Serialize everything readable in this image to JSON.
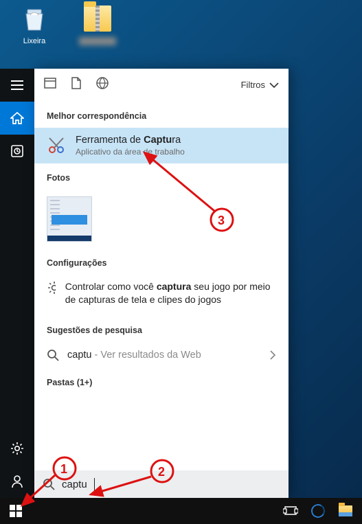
{
  "desktop": {
    "recycle_bin_label": "Lixeira",
    "zip_label_blurred": true
  },
  "rail": {
    "items": [
      "menu",
      "home",
      "timeline"
    ],
    "bottom": [
      "settings",
      "account"
    ]
  },
  "panel": {
    "filters_label": "Filtros",
    "best_match_label": "Melhor correspondência",
    "top_result": {
      "title_pre": "Ferramenta de ",
      "title_bold": "Captu",
      "title_post": "ra",
      "subtitle": "Aplicativo da área de trabalho"
    },
    "photos_label": "Fotos",
    "settings_label": "Configurações",
    "settings_row": {
      "pre": "Controlar como você ",
      "bold": "captura",
      "post": " seu jogo por meio de capturas de tela e clipes do jogos"
    },
    "suggestions_label": "Sugestões de pesquisa",
    "search_suggestion": {
      "term": "captu",
      "rest": " - Ver resultados da Web"
    },
    "folders_label": "Pastas (1+)"
  },
  "search": {
    "value": "captu"
  },
  "annotations": {
    "1": "1",
    "2": "2",
    "3": "3"
  },
  "icons": {
    "hamburger": "hamburger-icon",
    "home": "home-icon",
    "timeline": "timeline-icon",
    "gear": "gear-icon",
    "person": "person-icon",
    "windows": "windows-icon",
    "taskview": "task-view-icon",
    "edge": "edge-icon",
    "explorer": "file-explorer-icon",
    "recent": "recent-icon",
    "doc": "document-icon",
    "globe": "globe-icon",
    "chevron": "chevron-down-icon",
    "chevron_right": "chevron-right-icon",
    "search": "search-icon",
    "scissors": "snipping-tool-icon"
  }
}
